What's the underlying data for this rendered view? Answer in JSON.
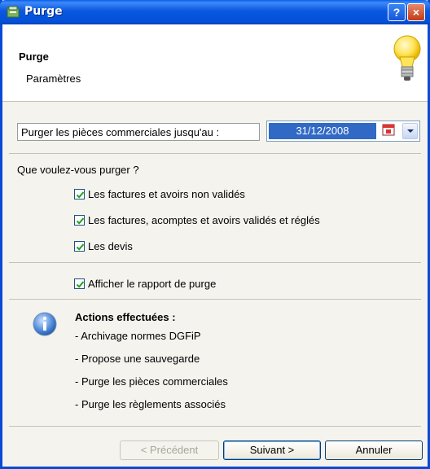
{
  "window": {
    "title": "Purge"
  },
  "titlebar": {
    "help_label": "?",
    "close_label": "×"
  },
  "header": {
    "title": "Purge",
    "subtitle": "Paramètres"
  },
  "date_row": {
    "label": "Purger les pièces commerciales jusqu'au :",
    "value": "31/12/2008"
  },
  "question": "Que voulez-vous purger ?",
  "options": [
    {
      "label": "Les factures et avoirs non validés",
      "checked": true
    },
    {
      "label": "Les factures, acomptes et avoirs validés et réglés",
      "checked": true
    },
    {
      "label": "Les devis",
      "checked": true
    }
  ],
  "report_option": {
    "label": "Afficher le rapport de purge",
    "checked": true
  },
  "actions": {
    "title": "Actions effectuées :",
    "items": [
      "- Archivage normes DGFiP",
      "- Propose une sauvegarde",
      "- Purge les pièces commerciales",
      "- Purge les règlements associés"
    ]
  },
  "buttons": {
    "previous": "< Précédent",
    "next": "Suivant >",
    "cancel": "Annuler"
  }
}
